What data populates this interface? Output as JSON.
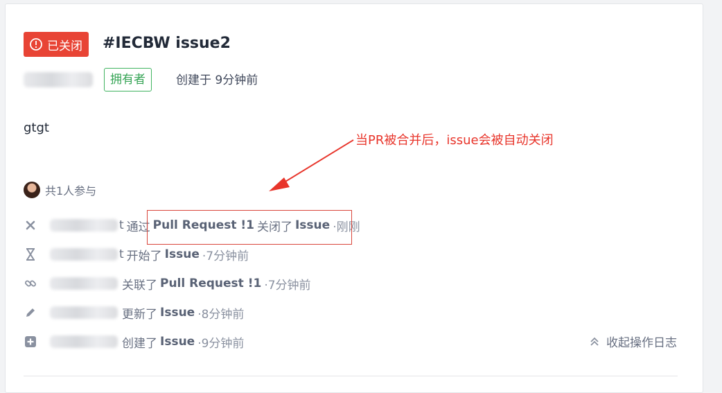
{
  "issue": {
    "status": "已关闭",
    "title": "#IECBW issue2",
    "owner_tag": "拥有者",
    "created": "创建于 9分钟前",
    "description": "gtgt"
  },
  "annotation": {
    "text": "当PR被合并后，issue会被自动关闭",
    "color": "#e8352b"
  },
  "participants": {
    "label": "共1人参与"
  },
  "activity": [
    {
      "icon": "close-icon",
      "user_tail": "t",
      "action": "通过",
      "target": "Pull Request !1",
      "action2": "关闭了",
      "target2": "Issue",
      "time": "·刚刚"
    },
    {
      "icon": "hourglass-icon",
      "user_tail": "t",
      "action": "开始了",
      "target": "Issue",
      "time": "·7分钟前"
    },
    {
      "icon": "link-icon",
      "user_tail": "",
      "action": "关联了",
      "target": "Pull Request !1",
      "time": "·7分钟前"
    },
    {
      "icon": "pencil-icon",
      "user_tail": "",
      "action": "更新了",
      "target": "Issue",
      "time": "·8分钟前"
    },
    {
      "icon": "plus-square-icon",
      "user_tail": "",
      "action": "创建了",
      "target": "Issue",
      "time": "·9分钟前"
    }
  ],
  "collapse_log": "收起操作日志",
  "colors": {
    "closed_badge": "#e84435",
    "owner_green": "#3fb35f",
    "highlight_red": "#d9443a"
  }
}
